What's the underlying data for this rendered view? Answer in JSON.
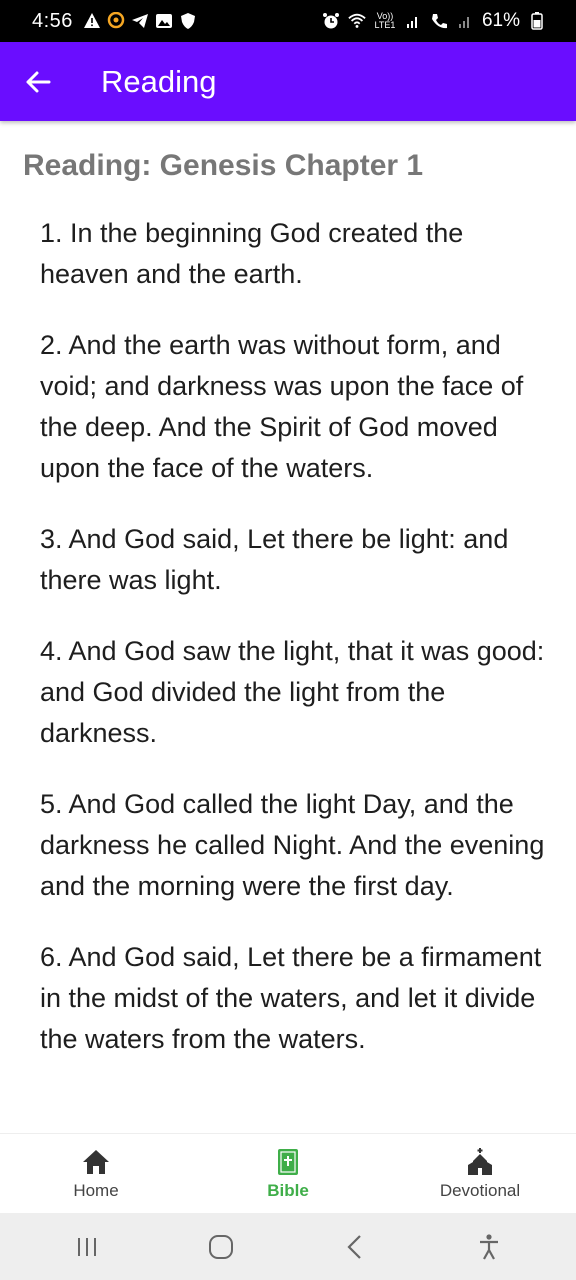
{
  "status_bar": {
    "time": "4:56",
    "battery_text": "61%",
    "lte_label": "Vo)) LTE1",
    "left_icons": [
      "warning-icon",
      "chat-icon",
      "telegram-icon",
      "gallery-icon",
      "shield-icon"
    ],
    "right_icons": [
      "alarm-icon",
      "wifi-icon",
      "signal-icon",
      "call-icon",
      "signal-icon",
      "battery-icon"
    ]
  },
  "app_bar": {
    "title": "Reading",
    "back_icon": "arrow-left-icon",
    "color": "#6a0dff"
  },
  "main": {
    "heading": "Reading: Genesis Chapter 1",
    "verses": [
      "1. In the beginning God created the heaven and the earth.",
      "2. And the earth was without form, and void; and darkness was upon the face of the deep. And the Spirit of God moved upon the face of the waters.",
      "3. And God said, Let there be light: and there was light.",
      "4. And God saw the light, that it was good: and God divided the light from the darkness.",
      "5. And God called the light Day, and the darkness he called Night. And the evening and the morning were the first day.",
      "6. And God said, Let there be a firmament in the midst of the waters, and let it divide the waters from the waters."
    ]
  },
  "bottom_nav": {
    "items": [
      {
        "label": "Home",
        "icon": "home-icon",
        "active": false
      },
      {
        "label": "Bible",
        "icon": "bible-icon",
        "active": true
      },
      {
        "label": "Devotional",
        "icon": "church-icon",
        "active": false
      }
    ],
    "active_color": "#3fae49"
  },
  "system_nav": {
    "buttons": [
      "recents-icon",
      "home-circle-icon",
      "back-chevron-icon",
      "accessibility-icon"
    ]
  }
}
